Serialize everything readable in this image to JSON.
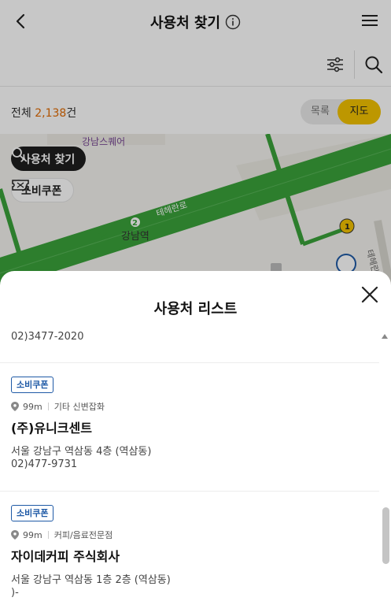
{
  "header": {
    "title": "사용처 찾기"
  },
  "summary": {
    "total_prefix": "전체 ",
    "total_count": "2,138",
    "total_suffix": "건"
  },
  "view_toggle": {
    "list_label": "목록",
    "map_label": "지도",
    "selected": "지도"
  },
  "map": {
    "search_chip_label": "사용처 찾기",
    "coupon_chip_label": "소비쿠폰",
    "labels": {
      "gangnam_square": "강남스퀘어",
      "teheran_ro": "테헤란로",
      "gangnam_station": "강남역",
      "station_line_number": "2",
      "marker_number": "1",
      "teheran_ro_2": "테헤란로"
    }
  },
  "sheet": {
    "title": "사용처 리스트",
    "first_item_phone": "02)3477-2020",
    "items": [
      {
        "badge": "소비쿠폰",
        "distance": "99m",
        "category": "기타 신변잡화",
        "name": "(주)유니크센트",
        "address": "서울 강남구 역삼동 4층 (역삼동)",
        "phone": "02)477-9731"
      },
      {
        "badge": "소비쿠폰",
        "distance": "99m",
        "category": "커피/음료전문점",
        "name": "자이데커피 주식회사",
        "address": "서울 강남구 역삼동 1층 2층 (역삼동)",
        "phone": ")-"
      }
    ]
  },
  "colors": {
    "accent_yellow": "#f2c200",
    "count_orange": "#e06a00",
    "badge_blue": "#1f5aa6",
    "map_line_green": "#3aa23a"
  }
}
